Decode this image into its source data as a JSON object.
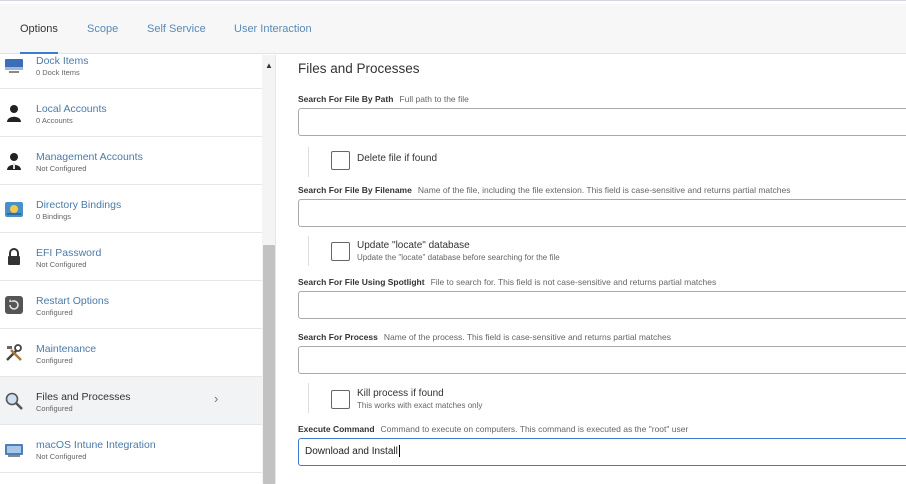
{
  "tabs": [
    "Options",
    "Scope",
    "Self Service",
    "User Interaction"
  ],
  "sidebar": {
    "items": [
      {
        "name": "Dock Items",
        "sub": "0 Dock Items",
        "icon": "dock-icon"
      },
      {
        "name": "Local Accounts",
        "sub": "0 Accounts",
        "icon": "user-icon"
      },
      {
        "name": "Management Accounts",
        "sub": "Not Configured",
        "icon": "admin-user-icon"
      },
      {
        "name": "Directory Bindings",
        "sub": "0 Bindings",
        "icon": "directory-icon"
      },
      {
        "name": "EFI Password",
        "sub": "Not Configured",
        "icon": "lock-icon"
      },
      {
        "name": "Restart Options",
        "sub": "Configured",
        "icon": "restart-icon"
      },
      {
        "name": "Maintenance",
        "sub": "Configured",
        "icon": "tools-icon"
      },
      {
        "name": "Files and Processes",
        "sub": "Configured",
        "icon": "magnifier-icon"
      },
      {
        "name": "macOS Intune Integration",
        "sub": "Not Configured",
        "icon": "intune-icon"
      }
    ],
    "selected_chevron": "›"
  },
  "main": {
    "title": "Files and Processes",
    "path": {
      "label": "Search For File By Path",
      "hint": "Full path to the file",
      "value": ""
    },
    "delete_file": {
      "label": "Delete file if found",
      "checked": false
    },
    "filename": {
      "label": "Search For File By Filename",
      "hint": "Name of the file, including the file extension. This field is case-sensitive and returns partial matches",
      "value": ""
    },
    "update_locate": {
      "label": "Update \"locate\" database",
      "sub": "Update the \"locate\" database before searching for the file",
      "checked": false
    },
    "spotlight": {
      "label": "Search For File Using Spotlight",
      "hint": "File to search for. This field is not case-sensitive and returns partial matches",
      "value": ""
    },
    "process": {
      "label": "Search For Process",
      "hint": "Name of the process. This field is case-sensitive and returns partial matches",
      "value": ""
    },
    "kill_process": {
      "label": "Kill process if found",
      "sub": "This works with exact matches only",
      "checked": false
    },
    "execute": {
      "label": "Execute Command",
      "hint": "Command to execute on computers. This command is executed as the \"root\" user",
      "value": "Download and Install"
    }
  },
  "colors": {
    "accent": "#3d7bd0",
    "link": "#4b7aa8"
  }
}
